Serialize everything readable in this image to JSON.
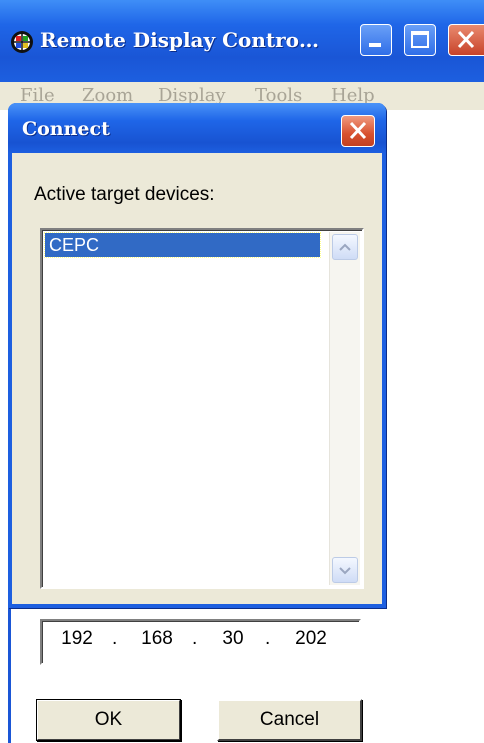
{
  "window": {
    "title": "Remote Display Contro…",
    "icon": "display-controller-icon",
    "accent": "#1d5fe0"
  },
  "menu": [
    "File",
    "Zoom",
    "Display",
    "Tools",
    "Help"
  ],
  "dialog": {
    "title": "Connect",
    "list_label": "Active target devices:",
    "devices": [
      "CEPC"
    ],
    "selected_device": "CEPC",
    "ip": [
      "192",
      "168",
      "30",
      "202"
    ],
    "ok_label": "OK",
    "cancel_label": "Cancel",
    "selection_color": "#316ac5"
  }
}
